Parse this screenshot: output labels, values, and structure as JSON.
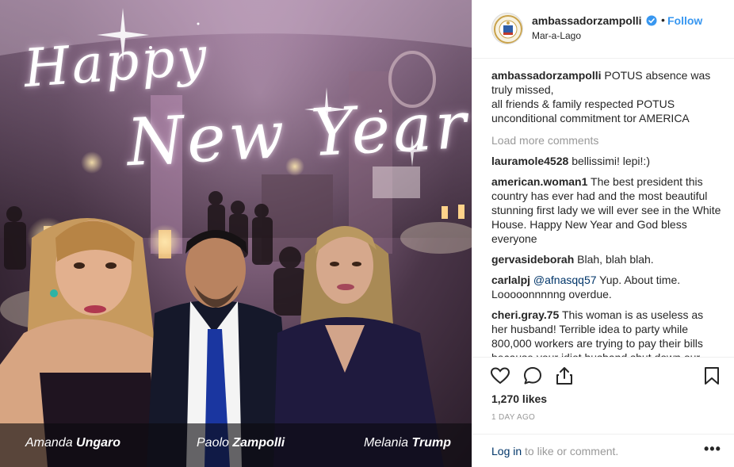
{
  "post": {
    "greeting_line1": "Happy",
    "greeting_line2": "New Year",
    "people": [
      {
        "first": "Amanda",
        "last": "Ungaro"
      },
      {
        "first": "Paolo",
        "last": "Zampolli"
      },
      {
        "first": "Melania",
        "last": "Trump"
      }
    ]
  },
  "header": {
    "username": "ambassadorzampolli",
    "dot": "•",
    "follow_label": "Follow",
    "location": "Mar-a-Lago"
  },
  "caption": {
    "username": "ambassadorzampolli",
    "text": "POTUS absence was truly missed,\nall friends & family respected POTUS unconditional commitment tor AMERICA"
  },
  "load_more_label": "Load more comments",
  "comments": [
    {
      "user": "lauramole4528",
      "mention": "",
      "text": "bellissimi! lepi!:)"
    },
    {
      "user": "american.woman1",
      "mention": "",
      "text": "The best president this country has ever had and the most beautiful stunning first lady we will ever see in the White House. Happy New Year and God bless everyone"
    },
    {
      "user": "gervasideborah",
      "mention": "",
      "text": "Blah, blah blah."
    },
    {
      "user": "carlalpj",
      "mention": "@afnasqq57",
      "text": "Yup. About time. Looooonnnnng overdue."
    },
    {
      "user": "cheri.gray.75",
      "mention": "",
      "text": "This woman is as useless as her husband! Terrible idea to party while 800,000 workers are trying to pay their bills because your idiot husband shut down our"
    }
  ],
  "actions": {
    "likes": "1,270 likes",
    "date": "1 DAY AGO",
    "login_link": "Log in",
    "login_rest": "to like or comment.",
    "more": "•••"
  },
  "icons": [
    "heart-icon",
    "comment-icon",
    "share-icon",
    "bookmark-icon",
    "verified-badge-icon"
  ],
  "colors": {
    "link": "#3897f0",
    "muted": "#999999",
    "text": "#262626"
  }
}
